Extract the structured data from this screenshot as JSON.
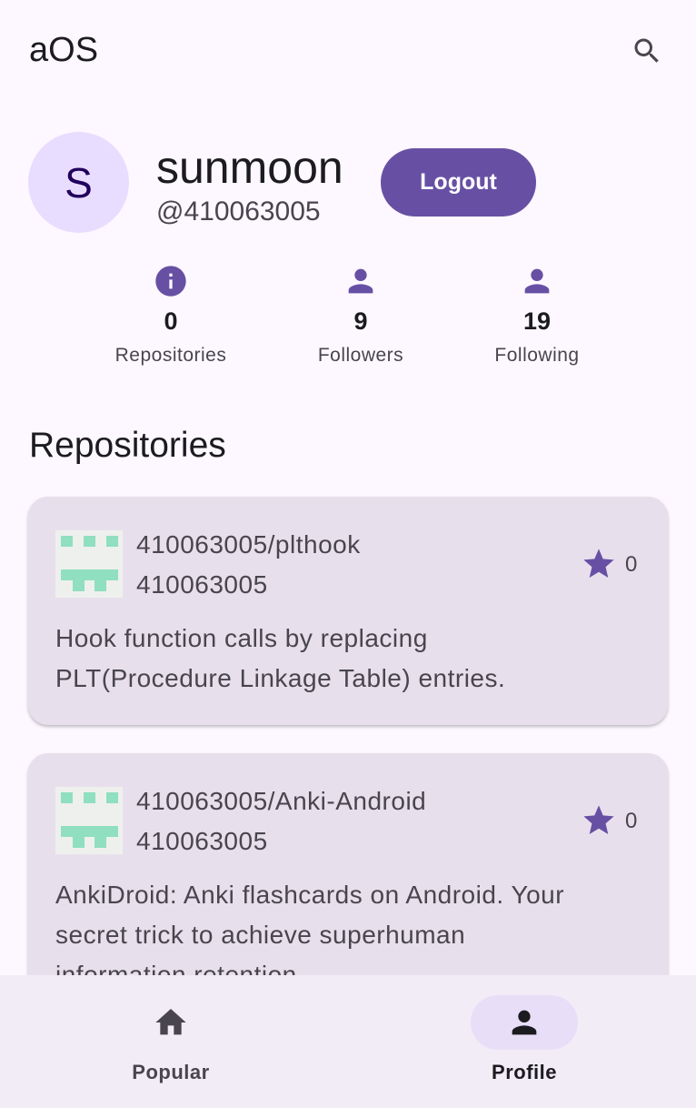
{
  "app": {
    "title": "aOS"
  },
  "profile": {
    "avatar_letter": "S",
    "username": "sunmoon",
    "handle": "@410063005",
    "logout_label": "Logout"
  },
  "stats": [
    {
      "value": "0",
      "label": "Repositories",
      "icon": "info-icon"
    },
    {
      "value": "9",
      "label": "Followers",
      "icon": "person-icon"
    },
    {
      "value": "19",
      "label": "Following",
      "icon": "person-icon"
    }
  ],
  "repositories": {
    "title": "Repositories",
    "items": [
      {
        "name": "410063005/plthook",
        "owner": "410063005",
        "stars": "0",
        "description_lines": [
          "Hook function calls by replacing",
          "PLT(Procedure Linkage Table) entries."
        ]
      },
      {
        "name": "410063005/Anki-Android",
        "owner": "410063005",
        "stars": "0",
        "description_lines": [
          "AnkiDroid: Anki flashcards on Android. Your",
          "secret trick to achieve superhuman",
          "information retention."
        ]
      }
    ]
  },
  "nav": {
    "items": [
      {
        "label": "Popular",
        "icon": "home-icon",
        "active": false
      },
      {
        "label": "Profile",
        "icon": "person-icon",
        "active": true
      }
    ]
  },
  "colors": {
    "primary": "#6750a4",
    "avatar_bg": "#e9ddff",
    "card_bg": "#e7e0ec",
    "identicon": "#8fdfc0",
    "nav_bg": "#f2ecf6"
  }
}
